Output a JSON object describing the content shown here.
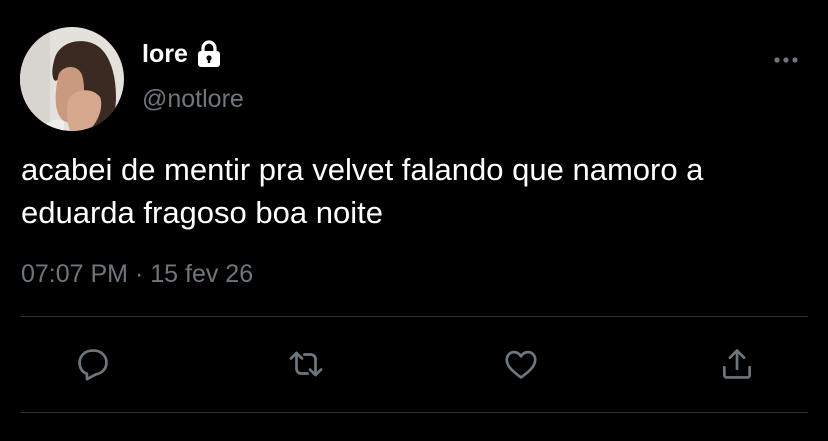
{
  "author": {
    "display_name": "lore",
    "handle": "@notlore",
    "protected": true,
    "avatar_icon": "profile-photo"
  },
  "tweet": {
    "text": "acabei de mentir pra velvet falando que namoro a eduarda fragoso boa noite",
    "time": "07:07 PM",
    "separator": "·",
    "date": "15 fev 26"
  },
  "icons": {
    "lock": "lock-icon",
    "more": "more-dots-icon",
    "reply": "reply-icon",
    "retweet": "retweet-icon",
    "like": "heart-icon",
    "share": "share-icon"
  },
  "colors": {
    "background": "#000000",
    "text": "#ffffff",
    "secondary": "#6e767d",
    "divider": "#2f3336"
  }
}
